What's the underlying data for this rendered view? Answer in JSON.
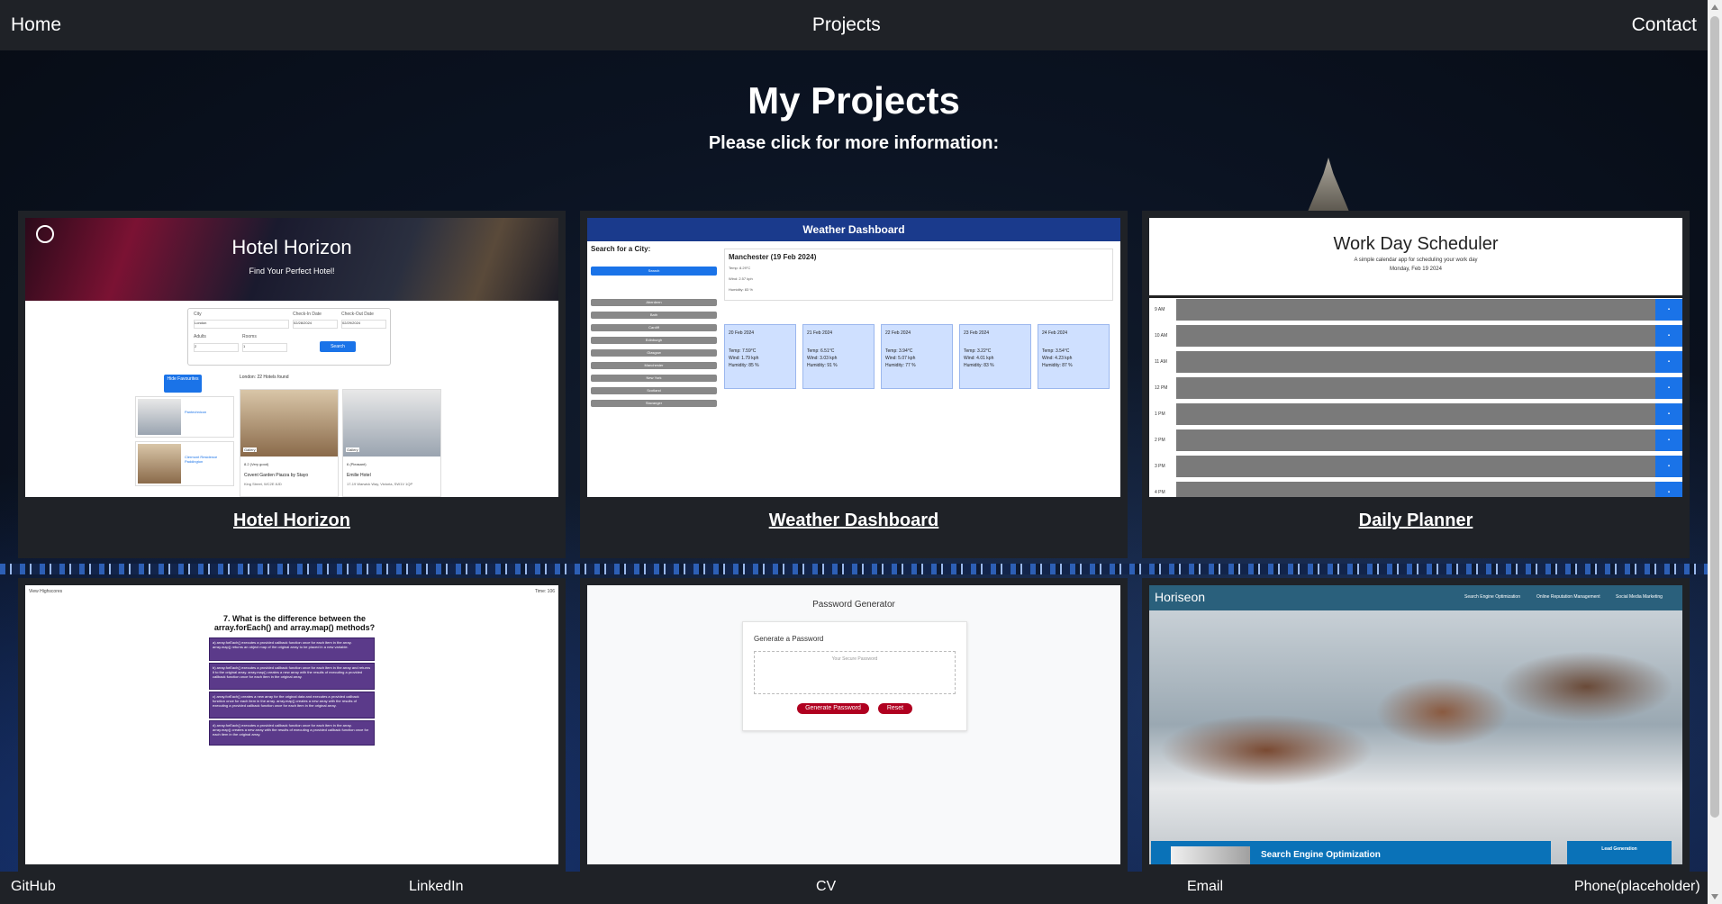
{
  "nav": {
    "home": "Home",
    "projects": "Projects",
    "contact": "Contact"
  },
  "hero": {
    "title": "My Projects",
    "subtitle": "Please click for more information:"
  },
  "projects": [
    {
      "title": "Hotel Horizon",
      "thumb": {
        "heading": "Hotel Horizon",
        "tagline": "Find Your Perfect Hotel!",
        "labels": [
          "City",
          "Check-In Date",
          "Check-Out Date",
          "Adults",
          "Rooms"
        ],
        "city_value": "London",
        "checkin_value": "02/28/2024",
        "checkout_value": "02/29/2024",
        "adults_value": "2",
        "rooms_value": "1",
        "search_button": "Search",
        "favourites_button": "Hide Favourites",
        "results_text": "London: 22 Hotels found",
        "hotels": [
          {
            "name": "Covent Garden Piazza by Stayo",
            "rating": "8.2 (Very good)",
            "address": "King Street, WC2E 8JD",
            "tag": "Gallery"
          },
          {
            "name": "Emilie Hotel",
            "rating": "6 (Pleasant)",
            "address": "17-19 Warwick Way, Victoria, SW1V 1QP",
            "tag": "Gallery"
          }
        ],
        "favourites": [
          "Pantechnicon",
          "Clermont Residence Paddington"
        ]
      }
    },
    {
      "title": "Weather Dashboard",
      "thumb": {
        "heading": "Weather Dashboard",
        "search_label": "Search for a City:",
        "search_button": "Search",
        "cities": [
          "Aberdeen",
          "Bath",
          "Cardiff",
          "Edinburgh",
          "Glasgow",
          "Manchester",
          "New York",
          "Scotland",
          "Stavanger"
        ],
        "today_heading": "Manchester (19 Feb 2024)",
        "today_lines": [
          "Temp: 8.29°C",
          "Wind: 2.57 kph",
          "Humidity: 83 %"
        ],
        "forecast": [
          {
            "date": "20 Feb 2024",
            "temp": "Temp: 7.59°C",
            "wind": "Wind: 1.79 kph",
            "humidity": "Humidity: 85 %"
          },
          {
            "date": "21 Feb 2024",
            "temp": "Temp: 6.51°C",
            "wind": "Wind: 3.03 kph",
            "humidity": "Humidity: 91 %"
          },
          {
            "date": "22 Feb 2024",
            "temp": "Temp: 3.94°C",
            "wind": "Wind: 5.07 kph",
            "humidity": "Humidity: 77 %"
          },
          {
            "date": "23 Feb 2024",
            "temp": "Temp: 3.22°C",
            "wind": "Wind: 4.01 kph",
            "humidity": "Humidity: 83 %"
          },
          {
            "date": "24 Feb 2024",
            "temp": "Temp: 3.54°C",
            "wind": "Wind: 4.23 kph",
            "humidity": "Humidity: 87 %"
          }
        ]
      }
    },
    {
      "title": "Daily Planner",
      "thumb": {
        "heading": "Work Day Scheduler",
        "tagline": "A simple calendar app for scheduling your work day",
        "date": "Monday, Feb 19 2024",
        "hours": [
          "9 AM",
          "10 AM",
          "11 AM",
          "12 PM",
          "1 PM",
          "2 PM",
          "3 PM",
          "4 PM"
        ]
      }
    },
    {
      "title": "",
      "thumb": {
        "highscores_link": "View Highscores",
        "timer": "Time: 106",
        "question": "7. What is the difference between the array.forEach() and array.map() methods?",
        "options": [
          "a) array.forEach() executes a provided callback function once for each item in the array. array.map() returns an object map of the original array to be placed in a new variable.",
          "b) array.forEach() executes a provided callback function once for each item in the array and returns it to the original array. array.map() creates a new array with the results of executing a provided callback function once for each item in the original array.",
          "c) array.forEach() creates a new array for the original data and executes a provided callback function once for each item in the array. array.map() creates a new array with the results of executing a provided callback function once for each item in the original array.",
          "d) array.forEach() executes a provided callback function once for each item in the array. array.map() creates a new array with the results of executing a provided callback function once for each item in the original array."
        ]
      }
    },
    {
      "title": "",
      "thumb": {
        "heading": "Password Generator",
        "card_title": "Generate a Password",
        "placeholder": "Your Secure Password",
        "generate_button": "Generate Password",
        "reset_button": "Reset"
      }
    },
    {
      "title": "",
      "thumb": {
        "brand": "Horiseon",
        "nav": [
          "Search Engine Optimization",
          "Online Reputation Management",
          "Social Media Marketing"
        ],
        "section_heading": "Search Engine Optimization",
        "aside_heading": "Lead Generation"
      }
    }
  ],
  "footer": {
    "github": "GitHub",
    "linkedin": "LinkedIn",
    "cv": "CV",
    "email": "Email",
    "phone": "Phone(placeholder)"
  },
  "colors": {
    "nav_bg": "#1f2227",
    "card_bg": "#1f2227",
    "accent_blue": "#1a73e8"
  }
}
